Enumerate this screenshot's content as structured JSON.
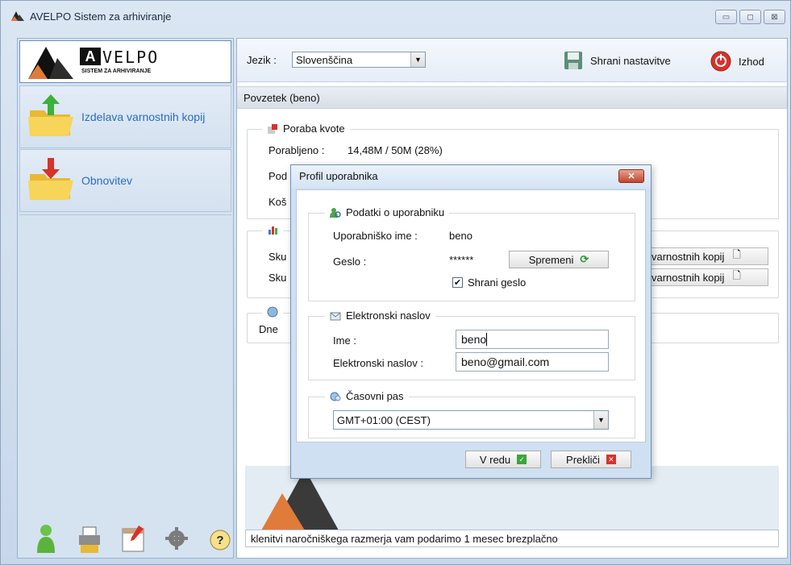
{
  "window": {
    "title": "AVELPO Sistem za arhiviranje",
    "minimize_glyph": "▭",
    "maximize_glyph": "◻",
    "close_glyph": "⊠"
  },
  "logo": {
    "brand": "VELPO",
    "subtitle": "SISTEM ZA ARHIVIRANJE"
  },
  "sidebar": {
    "items": [
      {
        "label": "Izdelava varnostnih kopij",
        "icon": "folder-upload-icon"
      },
      {
        "label": "Obnovitev",
        "icon": "folder-restore-icon"
      }
    ],
    "tools": [
      "user-icon",
      "printer-icon",
      "calendar-icon",
      "gear-icon",
      "help-icon"
    ]
  },
  "toolbar": {
    "language_label": "Jezik :",
    "language_value": "Slovenščina",
    "save_label": "Shrani nastavitve",
    "exit_label": "Izhod"
  },
  "summary": {
    "header": "Povzetek (beno)",
    "quota": {
      "title": "Poraba kvote",
      "used_label": "Porabljeno :",
      "used_value": "14,48M / 50M (28%)",
      "row2_label": "Pod",
      "row3_label": "Koš"
    },
    "jobs": {
      "row1_label": "Sku",
      "row2_label": "Sku",
      "btn1_label": "varnostnih kopij",
      "btn2_label": "varnostnih kopij"
    },
    "log": {
      "row_label": "Dne"
    },
    "ticker": "klenitvi naročniškega razmerja vam podarimo 1 mesec brezplačno"
  },
  "dialog": {
    "title": "Profil uporabnika",
    "close_glyph": "✕",
    "user_group": {
      "title": "Podatki o uporabniku",
      "username_label": "Uporabniško ime :",
      "username_value": "beno",
      "password_label": "Geslo :",
      "password_value": "******",
      "change_button": "Spremeni",
      "save_password_label": "Shrani geslo",
      "save_password_checked": true
    },
    "email_group": {
      "title": "Elektronski naslov",
      "name_label": "Ime :",
      "name_value": "beno",
      "email_label": "Elektronski naslov :",
      "email_value": "beno@gmail.com"
    },
    "timezone_group": {
      "title": "Časovni pas",
      "value": "GMT+01:00 (CEST)"
    },
    "ok_button": "V redu",
    "cancel_button": "Prekliči"
  }
}
